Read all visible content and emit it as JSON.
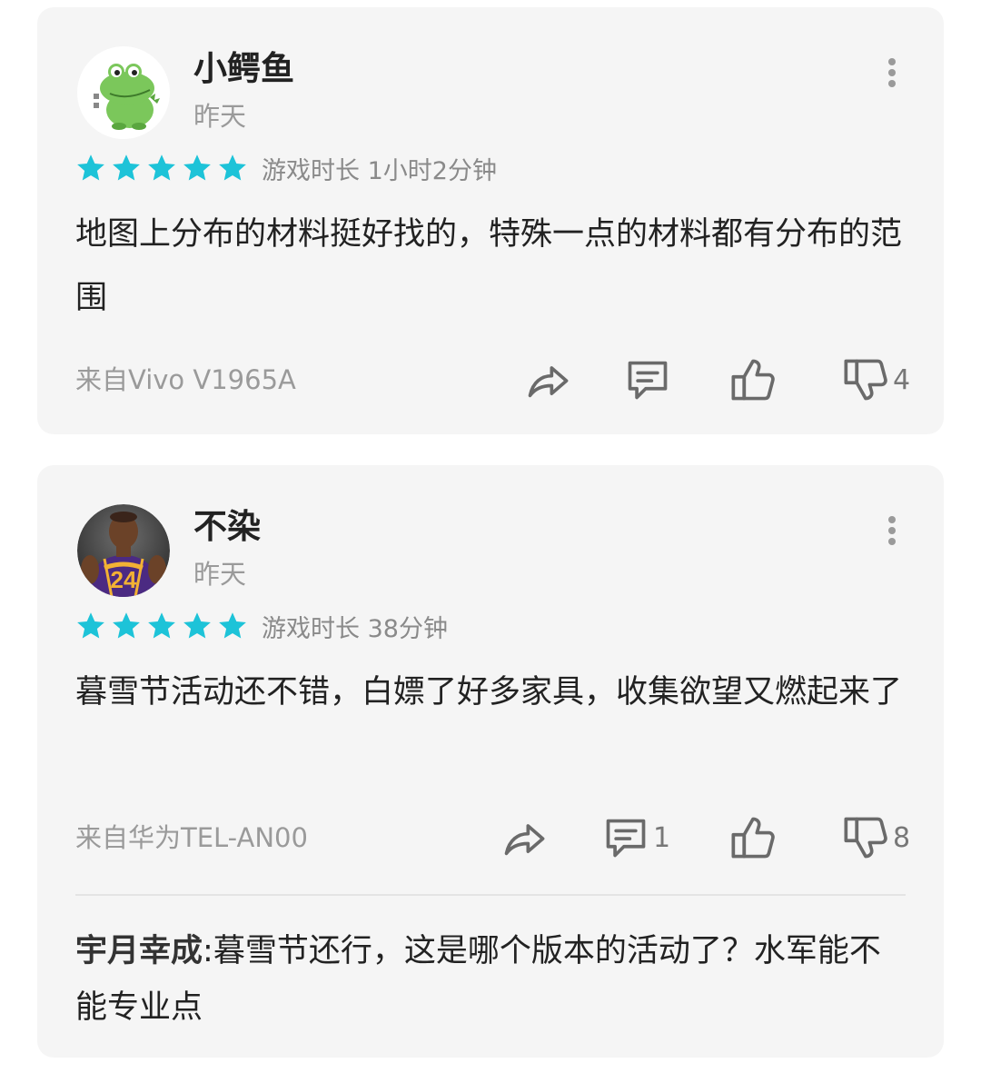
{
  "colors": {
    "star": "#1dc3d8",
    "icon": "#6a6a6a",
    "card_bg": "#f5f5f5",
    "muted_text": "#9a9a9a"
  },
  "reviews": [
    {
      "username": "小鳄鱼",
      "date": "昨天",
      "avatar_icon": "crocodile-avatar",
      "rating": 5,
      "playtime": "游戏时长 1小时2分钟",
      "text": "地图上分布的材料挺好找的，特殊一点的材料都有分布的范围",
      "device": "来自Vivo V1965A",
      "actions": {
        "share_icon": "share-icon",
        "comment_icon": "comment-icon",
        "comment_count": "",
        "like_icon": "thumbs-up-icon",
        "like_count": "",
        "dislike_icon": "thumbs-down-icon",
        "dislike_count": "4"
      }
    },
    {
      "username": "不染",
      "date": "昨天",
      "avatar_icon": "basketball-player-avatar",
      "rating": 5,
      "playtime": "游戏时长 38分钟",
      "text": "暮雪节活动还不错，白嫖了好多家具，收集欲望又燃起来了",
      "device": "来自华为TEL-AN00",
      "actions": {
        "share_icon": "share-icon",
        "comment_icon": "comment-icon",
        "comment_count": "1",
        "like_icon": "thumbs-up-icon",
        "like_count": "",
        "dislike_icon": "thumbs-down-icon",
        "dislike_count": "8"
      },
      "reply": {
        "author": "宇月幸成",
        "separator": ":",
        "text": "暮雪节还行，这是哪个版本的活动了？水军能不能专业点"
      }
    }
  ]
}
